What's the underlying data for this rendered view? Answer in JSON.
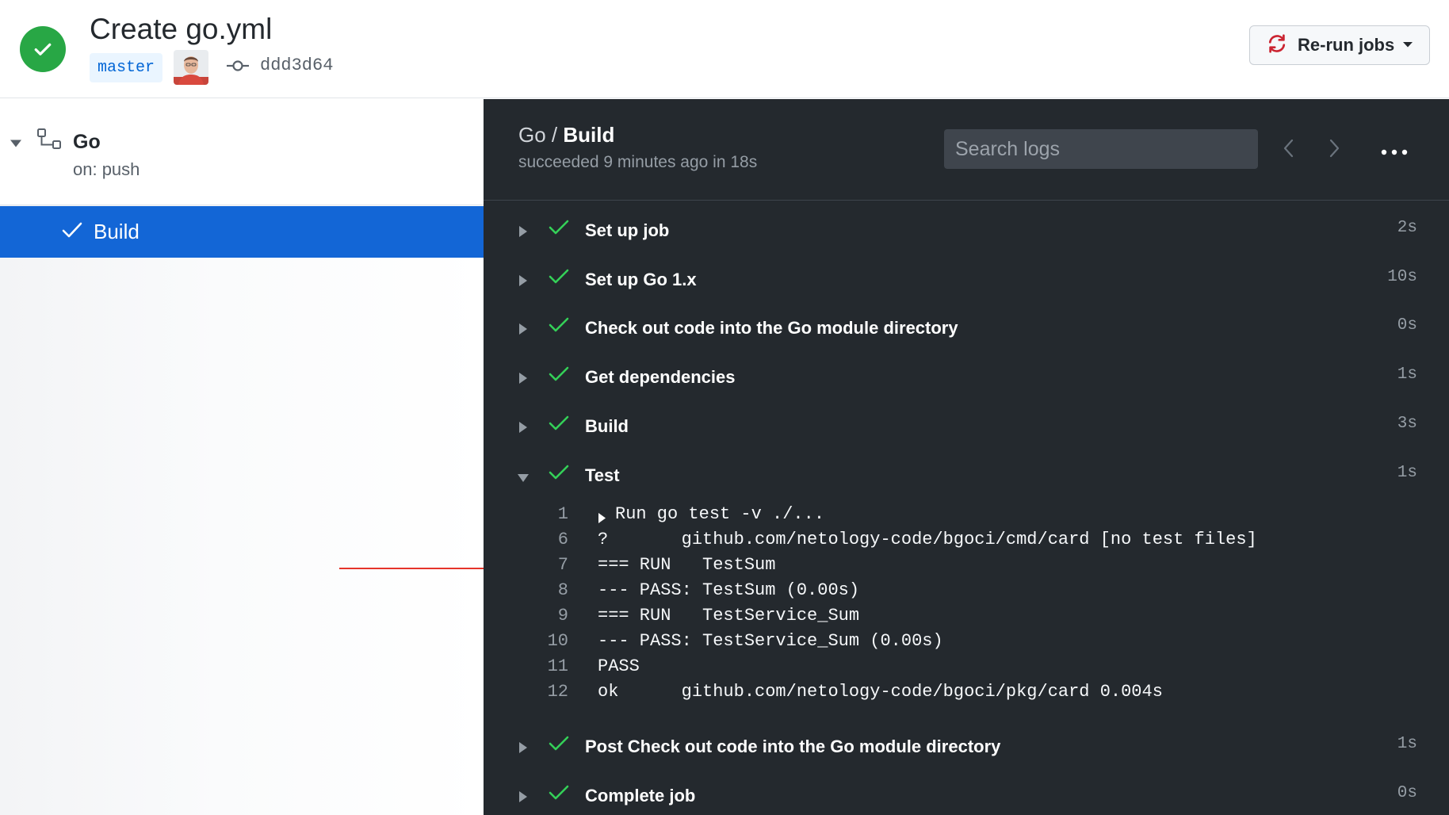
{
  "header": {
    "title": "Create go.yml",
    "branch": "master",
    "commit_sha": "ddd3d64",
    "rerun_label": "Re-run jobs"
  },
  "sidebar": {
    "workflow_name": "Go",
    "trigger": "on: push",
    "jobs": [
      {
        "label": "Build",
        "selected": true
      }
    ]
  },
  "log": {
    "workflow": "Go",
    "separator": "/",
    "job": "Build",
    "subtitle": "succeeded 9 minutes ago in 18s",
    "search_placeholder": "Search logs",
    "steps": [
      {
        "name": "Set up job",
        "time": "2s"
      },
      {
        "name": "Set up Go 1.x",
        "time": "10s"
      },
      {
        "name": "Check out code into the Go module directory",
        "time": "0s"
      },
      {
        "name": "Get dependencies",
        "time": "1s"
      },
      {
        "name": "Build",
        "time": "3s"
      },
      {
        "name": "Test",
        "time": "1s",
        "expanded": true
      },
      {
        "name": "Post Check out code into the Go module directory",
        "time": "1s"
      },
      {
        "name": "Complete job",
        "time": "0s"
      }
    ],
    "test_output": [
      {
        "n": "1",
        "text": "Run go test -v ./...",
        "collapsible": true
      },
      {
        "n": "6",
        "text": "?   \tgithub.com/netology-code/bgoci/cmd/card\t[no test files]"
      },
      {
        "n": "7",
        "text": "=== RUN   TestSum"
      },
      {
        "n": "8",
        "text": "--- PASS: TestSum (0.00s)"
      },
      {
        "n": "9",
        "text": "=== RUN   TestService_Sum"
      },
      {
        "n": "10",
        "text": "--- PASS: TestService_Sum (0.00s)"
      },
      {
        "n": "11",
        "text": "PASS"
      },
      {
        "n": "12",
        "text": "ok  \tgithub.com/netology-code/bgoci/pkg/card\t0.004s"
      }
    ]
  },
  "colors": {
    "success": "#28a745",
    "selected_job_bg": "#1366d6",
    "log_bg": "#24292e",
    "annotation_arrow": "#e5342a",
    "rerun_icon": "#cb2431"
  },
  "icons": {
    "status": "check-circle-icon",
    "commit": "git-commit-icon",
    "rerun": "sync-icon",
    "workflow": "workflow-icon",
    "step_status": "check-icon",
    "more": "kebab-horizontal-icon"
  }
}
